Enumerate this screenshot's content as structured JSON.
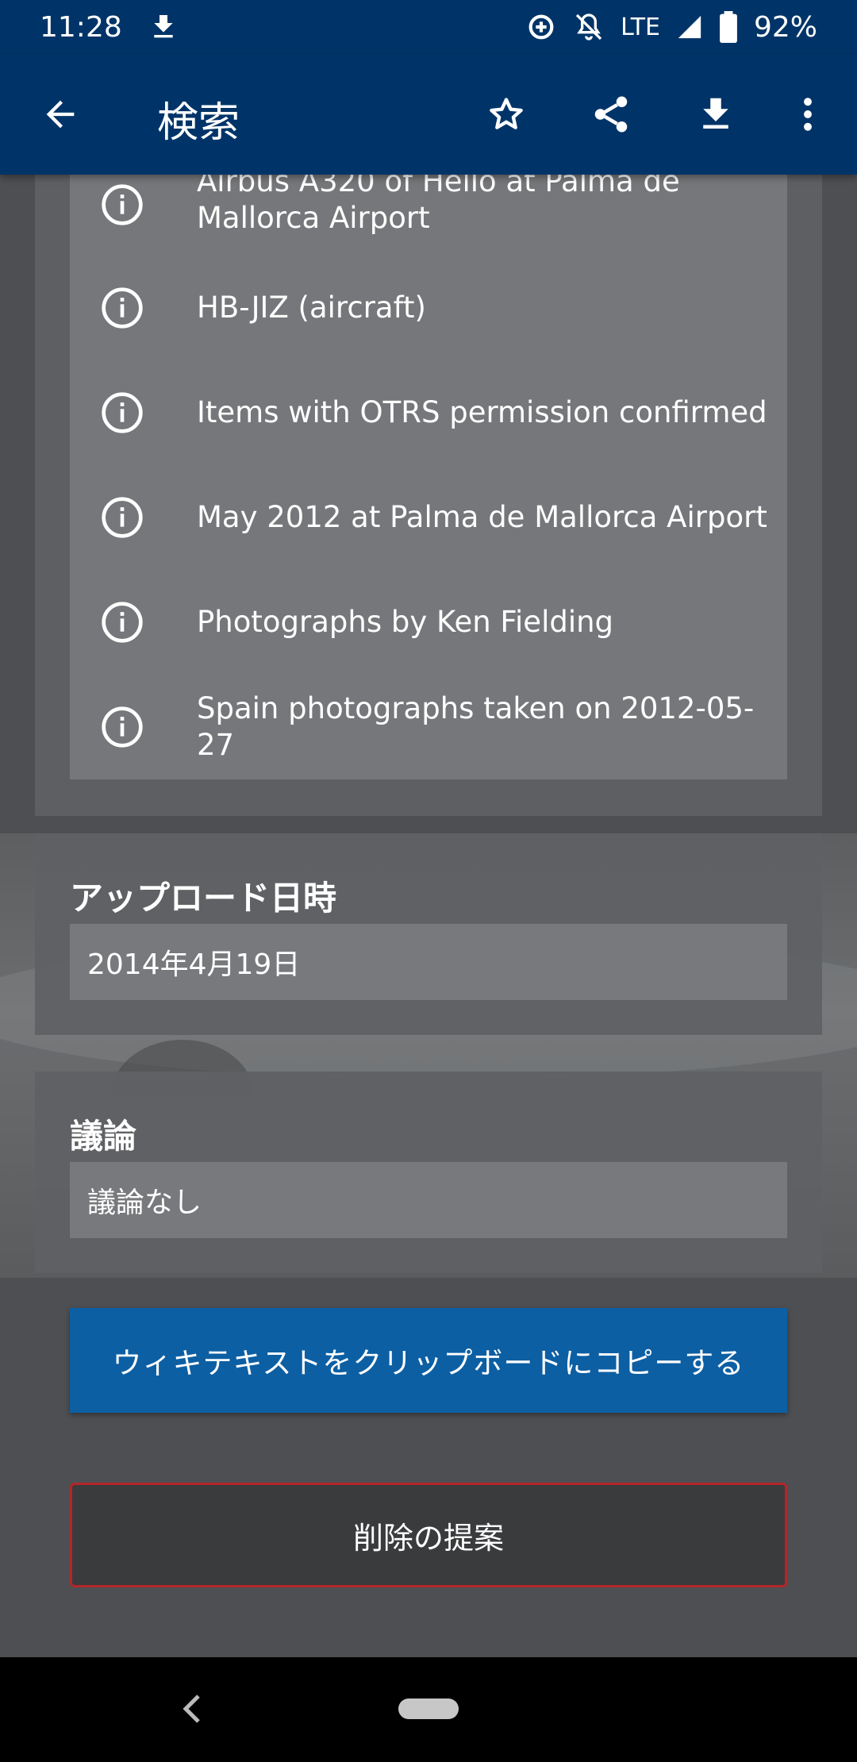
{
  "status_bar": {
    "time": "11:28",
    "network": "LTE",
    "battery": "92%",
    "icons": [
      "download-icon",
      "data-saver-icon",
      "mute-icon",
      "signal-icon",
      "battery-icon"
    ]
  },
  "app_bar": {
    "title": "検索",
    "icons": [
      "back-arrow-icon",
      "star-icon",
      "share-icon",
      "download-icon",
      "more-vert-icon"
    ]
  },
  "categories": [
    {
      "label_line1": "Airbus A320 of Hello at Palma de",
      "label_line2": "Mallorca Airport"
    },
    {
      "label": "HB-JIZ (aircraft)"
    },
    {
      "label": "Items with OTRS permission confirmed"
    },
    {
      "label": "May 2012 at Palma de Mallorca Airport"
    },
    {
      "label": "Photographs by Ken Fielding"
    },
    {
      "label": "Spain photographs taken on 2012-05-27"
    }
  ],
  "upload": {
    "title": "アップロード日時",
    "value": "2014年4月19日"
  },
  "talk": {
    "title": "議論",
    "value": "議論なし"
  },
  "buttons": {
    "copy_wikitext": "ウィキテキストをクリップボードにコピーする",
    "nominate_delete": "削除の提案"
  },
  "colors": {
    "app_bar": "#003468",
    "primary_button": "#0d5fa3",
    "delete_border": "#b3262a"
  }
}
